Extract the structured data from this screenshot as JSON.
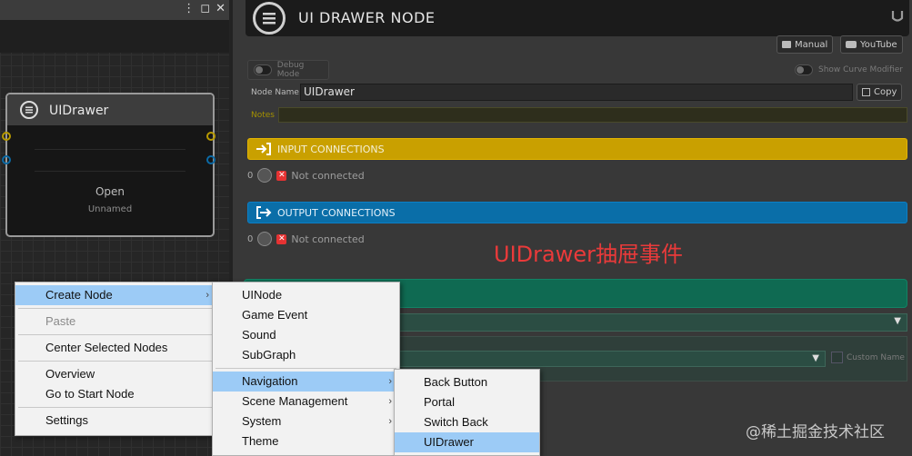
{
  "graph": {
    "window_controls": [
      "⋮",
      "◻",
      "✕"
    ],
    "node": {
      "title": "UIDrawer",
      "open_label": "Open",
      "name_label": "Unnamed"
    }
  },
  "inspector": {
    "title": "UI DRAWER NODE",
    "manual_label": "Manual",
    "youtube_label": "YouTube",
    "debug_mode_label": "Debug Mode",
    "show_curve_modifier_label": "Show Curve Modifier",
    "node_name_label": "Node Name",
    "node_name_value": "UIDrawer",
    "copy_label": "Copy",
    "notes_label": "Notes",
    "input_connections": {
      "label": "INPUT CONNECTIONS",
      "count": "0",
      "status": "Not connected",
      "color": "#e3b400"
    },
    "output_connections": {
      "label": "OUTPUT CONNECTIONS",
      "count": "0",
      "status": "Not connected",
      "color": "#0b7fc6"
    },
    "custom_name_label": "Custom Name"
  },
  "annotation": "UIDrawer抽屉事件",
  "watermark": "@稀土掘金技术社区",
  "context_menu": {
    "items": [
      {
        "label": "Create Node",
        "selected": true,
        "submenu": true
      },
      {
        "label": "Paste",
        "disabled": true
      },
      {
        "label": "Center Selected Nodes"
      },
      {
        "label": "Overview"
      },
      {
        "label": "Go to Start Node"
      },
      {
        "label": "Settings"
      }
    ]
  },
  "create_node_menu": {
    "items": [
      {
        "label": "UINode"
      },
      {
        "label": "Game Event"
      },
      {
        "label": "Sound"
      },
      {
        "label": "SubGraph"
      },
      {
        "label": "Navigation",
        "selected": true,
        "submenu": true
      },
      {
        "label": "Scene Management",
        "submenu": true
      },
      {
        "label": "System",
        "submenu": true
      },
      {
        "label": "Theme"
      }
    ]
  },
  "navigation_menu": {
    "items": [
      {
        "label": "Back Button"
      },
      {
        "label": "Portal"
      },
      {
        "label": "Switch Back"
      },
      {
        "label": "UIDrawer",
        "selected": true
      }
    ]
  }
}
